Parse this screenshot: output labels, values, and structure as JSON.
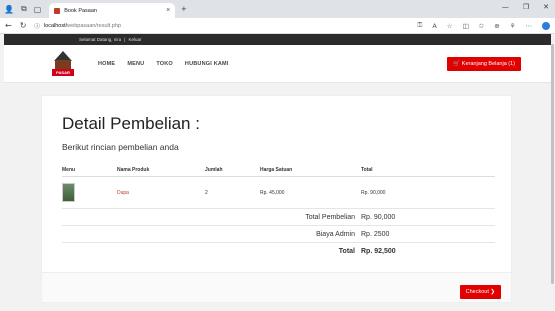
{
  "browser": {
    "tab_title": "Book Pasaan",
    "url_host": "localhost/",
    "url_path": "webpasaan/result.php"
  },
  "site": {
    "greeting": "Selamat Datang, nira",
    "separator": "|",
    "logout": "Keluar",
    "logo_text": "PASAR",
    "menu": [
      "HOME",
      "MENU",
      "TOKO",
      "HUBUNGI KAMI"
    ],
    "cart_button": "Keranjang Belanja (1)"
  },
  "detail": {
    "title": "Detail Pembelian :",
    "subtitle": "Berikut rincian pembelian anda",
    "table": {
      "headers": [
        "Menu",
        "Nama Produk",
        "Jumlah",
        "Harga Satuan",
        "Total"
      ],
      "rows": [
        {
          "product": "Dupa",
          "qty": "2",
          "unit_price": "Rp. 45,000",
          "total": "Rp. 90,000"
        }
      ]
    },
    "summary": [
      {
        "label": "Total Pembelian",
        "value": "Rp. 90,000"
      },
      {
        "label": "Biaya Admin",
        "value": "Rp. 2500"
      },
      {
        "label": "Total",
        "value": "Rp. 92,500"
      }
    ],
    "checkout_button": "Checkout"
  },
  "colors": {
    "accent": "#e00000",
    "topbar": "#2b2b2b"
  }
}
